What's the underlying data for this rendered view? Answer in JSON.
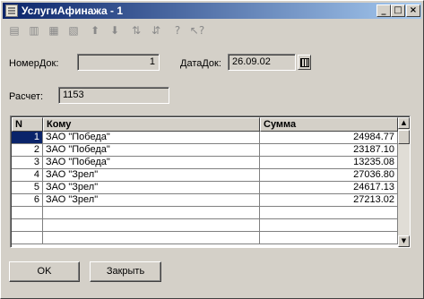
{
  "window": {
    "title": "УслугиАфинажа - 1",
    "controls": {
      "minimize": "_",
      "maximize": "□",
      "close": "×"
    }
  },
  "toolbar": {
    "items": [
      {
        "icon": "new-row-icon",
        "glyph": "▤"
      },
      {
        "icon": "copy-row-icon",
        "glyph": "▥"
      },
      {
        "icon": "delete-row-icon",
        "glyph": "▦"
      },
      {
        "icon": "edit-row-icon",
        "glyph": "▧"
      },
      {
        "icon": "move-up-icon",
        "glyph": "⬆"
      },
      {
        "icon": "move-down-icon",
        "glyph": "⬇"
      },
      {
        "icon": "sort-asc-icon",
        "glyph": "⇅"
      },
      {
        "icon": "sort-desc-icon",
        "glyph": "⇵"
      },
      {
        "icon": "help-icon",
        "glyph": "?"
      },
      {
        "icon": "context-help-icon",
        "glyph": "↖?"
      }
    ]
  },
  "form": {
    "doc_number_label": "НомерДок:",
    "doc_number_value": "1",
    "doc_date_label": "ДатаДок:",
    "doc_date_value": "26.09.02",
    "calc_label": "Расчет:",
    "calc_value": "1153"
  },
  "table": {
    "columns": [
      "N",
      "Кому",
      "Сумма"
    ],
    "rows": [
      [
        "1",
        "ЗАО \"Победа\"",
        "24984.77"
      ],
      [
        "2",
        "ЗАО \"Победа\"",
        "23187.10"
      ],
      [
        "3",
        "ЗАО \"Победа\"",
        "13235.08"
      ],
      [
        "4",
        "ЗАО \"Зрел\"",
        "27036.80"
      ],
      [
        "5",
        "ЗАО \"Зрел\"",
        "24617.13"
      ],
      [
        "6",
        "ЗАО \"Зрел\"",
        "27213.02"
      ],
      [
        "",
        "",
        ""
      ],
      [
        "",
        "",
        ""
      ],
      [
        "",
        "",
        ""
      ]
    ],
    "selected_row": 0
  },
  "buttons": {
    "ok": "OK",
    "close": "Закрыть"
  },
  "colors": {
    "titlebar_start": "#0a246a",
    "titlebar_end": "#a6caf0",
    "selection": "#0a246a"
  }
}
